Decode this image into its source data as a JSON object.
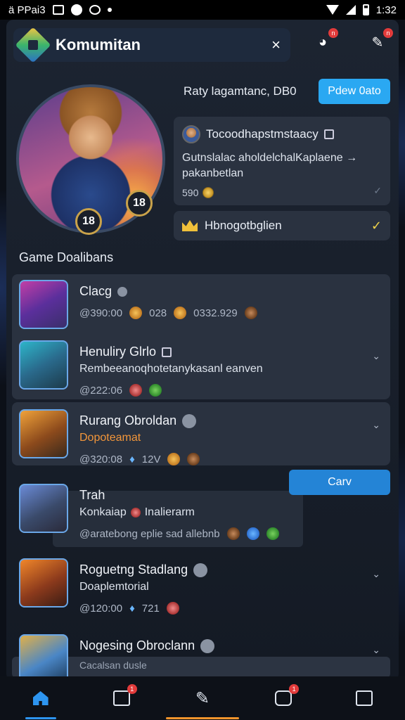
{
  "statusbar": {
    "left_text": "ä PPai3",
    "time": "1:32"
  },
  "header": {
    "title": "Komumitan",
    "close_icon": "×"
  },
  "header_badges": {
    "icon1": "n",
    "icon2": "n"
  },
  "profile": {
    "meta": "Raty lagamtanc,  DB0",
    "primary_button": "Pdew 0ato",
    "level_badge": "18",
    "level_badge_small": "18"
  },
  "notification": {
    "title": "Tocoodhapstmstaacy",
    "body_line1": "Gutnslalac aholdelchalKaplaene",
    "body_arrow": "→",
    "body_line2": "pakanbetlan",
    "count": "590",
    "chevron": "✓"
  },
  "dropdown": {
    "label": "Hbnogotbglien",
    "check": "✓"
  },
  "section_title": "Game Doalibans",
  "items": [
    {
      "title": "Clacg",
      "meta1": "@390:00",
      "meta2": "028",
      "meta3": "0332.929"
    },
    {
      "title": "Henuliry Glrlo",
      "sub": "Rembeeanoqhotetanykasanl eanven",
      "meta1": "@222:06"
    },
    {
      "title": "Rurang Obroldan",
      "sub": "Dopoteamat",
      "meta1": "@320:08",
      "meta2": "12V"
    },
    {
      "title": "Trah",
      "sub": "Konkaiap",
      "sub2": "Inalierarm",
      "meta1": "@aratebong eplie sad allebnb"
    },
    {
      "title": "Roguetng Stadlang",
      "sub": "Doaplemtorial",
      "meta1": "@120:00",
      "meta2": "721"
    },
    {
      "title": "Nogesing Obroclann",
      "sub": "Cacalsan dusle"
    }
  ],
  "secondary_button": "Carv",
  "bottom_nav": {
    "badge1": "1",
    "badge2": "1"
  },
  "colors": {
    "accent": "#2aa8f2",
    "panel": "#1c2431",
    "card": "#2a3240",
    "orange": "#f3963a"
  }
}
